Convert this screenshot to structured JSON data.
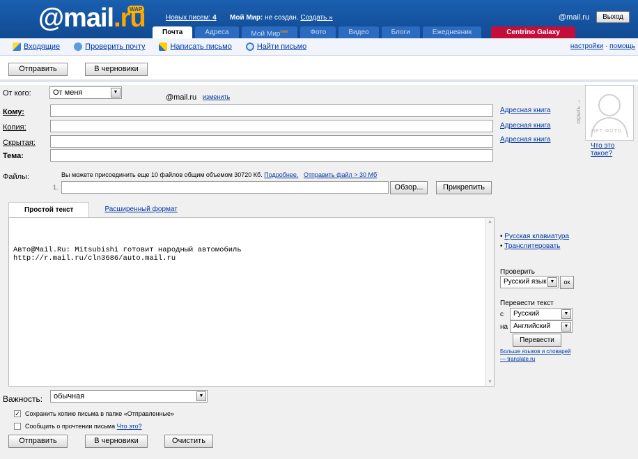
{
  "header": {
    "logo_main": "@mail",
    "logo_ru": ".ru",
    "wap": "WAP",
    "new_letters_label": "Новых писем:",
    "new_letters_count": "4",
    "my_world_label": "Мой Мир:",
    "my_world_status": "не создан.",
    "my_world_create": "Создать »",
    "account": "@mail.ru",
    "exit": "Выход",
    "tabs": [
      {
        "label": "Почта",
        "active": true
      },
      {
        "label": "Адреса"
      },
      {
        "label": "Мой Мир",
        "badge": "new"
      },
      {
        "label": "Фото"
      },
      {
        "label": "Видео"
      },
      {
        "label": "Блоги"
      },
      {
        "label": "Ежедневник"
      },
      {
        "label": "Centrino Galaxy",
        "promo": true
      }
    ]
  },
  "toolbar": {
    "inbox": "Входящие",
    "check": "Проверить почту",
    "write": "Написать письмо",
    "find": "Найти письмо",
    "settings": "настройки",
    "sep": "·",
    "help": "помощь"
  },
  "buttons": {
    "send": "Отправить",
    "drafts": "В черновики",
    "clear": "Очистить"
  },
  "form": {
    "from_label": "От кого:",
    "from_value": "От меня",
    "from_email": "@mail.ru",
    "change": "изменить",
    "to_label": "Кому:",
    "cc_label": "Копия:",
    "bcc_label": "Скрытая:",
    "subject_label": "Тема:",
    "address_book": "Адресная книга",
    "files_label": "Файлы:",
    "files_info": "Вы можете присоединить еще 10 файлов общим объемом 30720 Кб.",
    "more": "Подробнее.",
    "send_large": "Отправить файл > 30 Мб",
    "file_index": "1.",
    "browse": "Обзор...",
    "attach": "Прикрепить",
    "hide": "скрыть →",
    "no_photo": "НЕТ ФОТО",
    "what_is": "Что это такое?"
  },
  "editor": {
    "tab_plain": "Простой текст",
    "tab_rich": "Расширенный формат",
    "body_line1": "Авто@Mail.Ru: Mitsubishi готовит народный автомобиль",
    "body_line2": "http://r.mail.ru/cln3686/auto.mail.ru"
  },
  "side": {
    "ru_keyboard": "Русская клавиатура",
    "translit": "Транслитеровать",
    "check_label": "Проверить",
    "check_lang": "Русский язык",
    "ok": "ок",
    "translate_label": "Перевести текст",
    "from_prefix": "с",
    "from_lang": "Русский",
    "to_prefix": "на",
    "to_lang": "Английский",
    "translate_btn": "Перевести",
    "more_langs": "Больше языков и словарей",
    "translate_site": "— translate.ru"
  },
  "bottom": {
    "importance_label": "Важность:",
    "importance_value": "обычная",
    "save_copy": "Сохранить копию письма в папке «Отправленные»",
    "save_copy_checked": true,
    "notify": "Сообщить о прочтении письма",
    "what": "Что это?"
  }
}
